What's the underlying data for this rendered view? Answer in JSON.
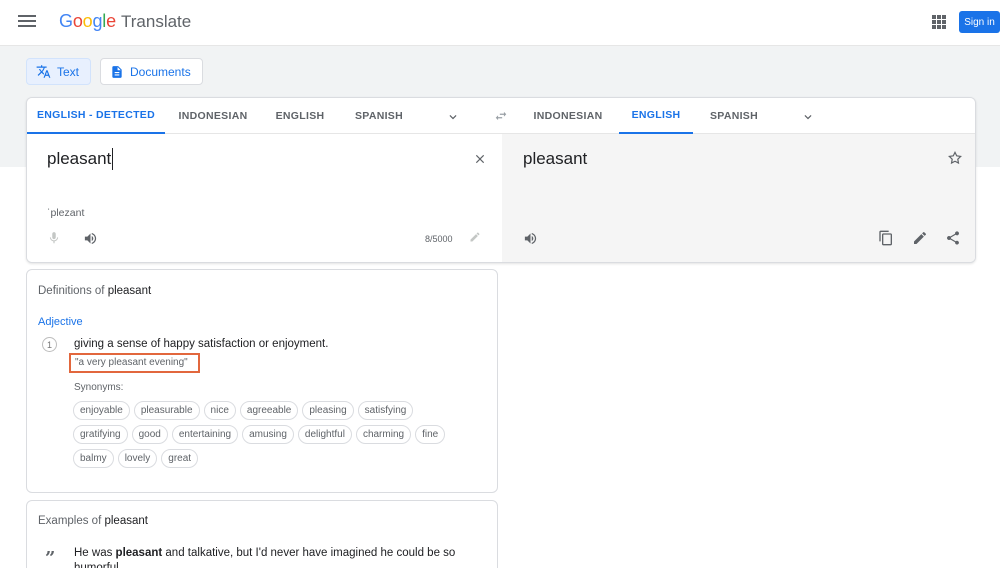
{
  "header": {
    "logo": [
      "G",
      "o",
      "o",
      "g",
      "l",
      "e"
    ],
    "app_name": "Translate",
    "signin_label": "Sign in"
  },
  "modes": {
    "text_label": "Text",
    "documents_label": "Documents"
  },
  "source_langs": [
    "ENGLISH - DETECTED",
    "INDONESIAN",
    "ENGLISH",
    "SPANISH"
  ],
  "target_langs": [
    "INDONESIAN",
    "ENGLISH",
    "SPANISH"
  ],
  "source": {
    "text": "pleasant",
    "phonetic": "ˈplezant",
    "char_count": "8/5000"
  },
  "target": {
    "text": "pleasant"
  },
  "definitions": {
    "title_prefix": "Definitions of",
    "word": "pleasant",
    "part_of_speech": "Adjective",
    "number": "1",
    "gloss": "giving a sense of happy satisfaction or enjoyment.",
    "example": "\"a very pleasant evening\"",
    "synonyms_label": "Synonyms:",
    "synonym_rows": [
      [
        "enjoyable",
        "pleasurable",
        "nice",
        "agreeable",
        "pleasing",
        "satisfying"
      ],
      [
        "gratifying",
        "good",
        "entertaining",
        "amusing",
        "delightful",
        "charming",
        "fine"
      ],
      [
        "balmy",
        "lovely",
        "great"
      ]
    ]
  },
  "examples": {
    "title_prefix": "Examples of",
    "word": "pleasant",
    "sentence_before": "He was ",
    "sentence_bold": "pleasant",
    "sentence_after": " and talkative, but I'd never have imagined he could be so humorful."
  },
  "colors": {
    "accent": "#1a73e8",
    "highlight_box": "#e2673d"
  }
}
